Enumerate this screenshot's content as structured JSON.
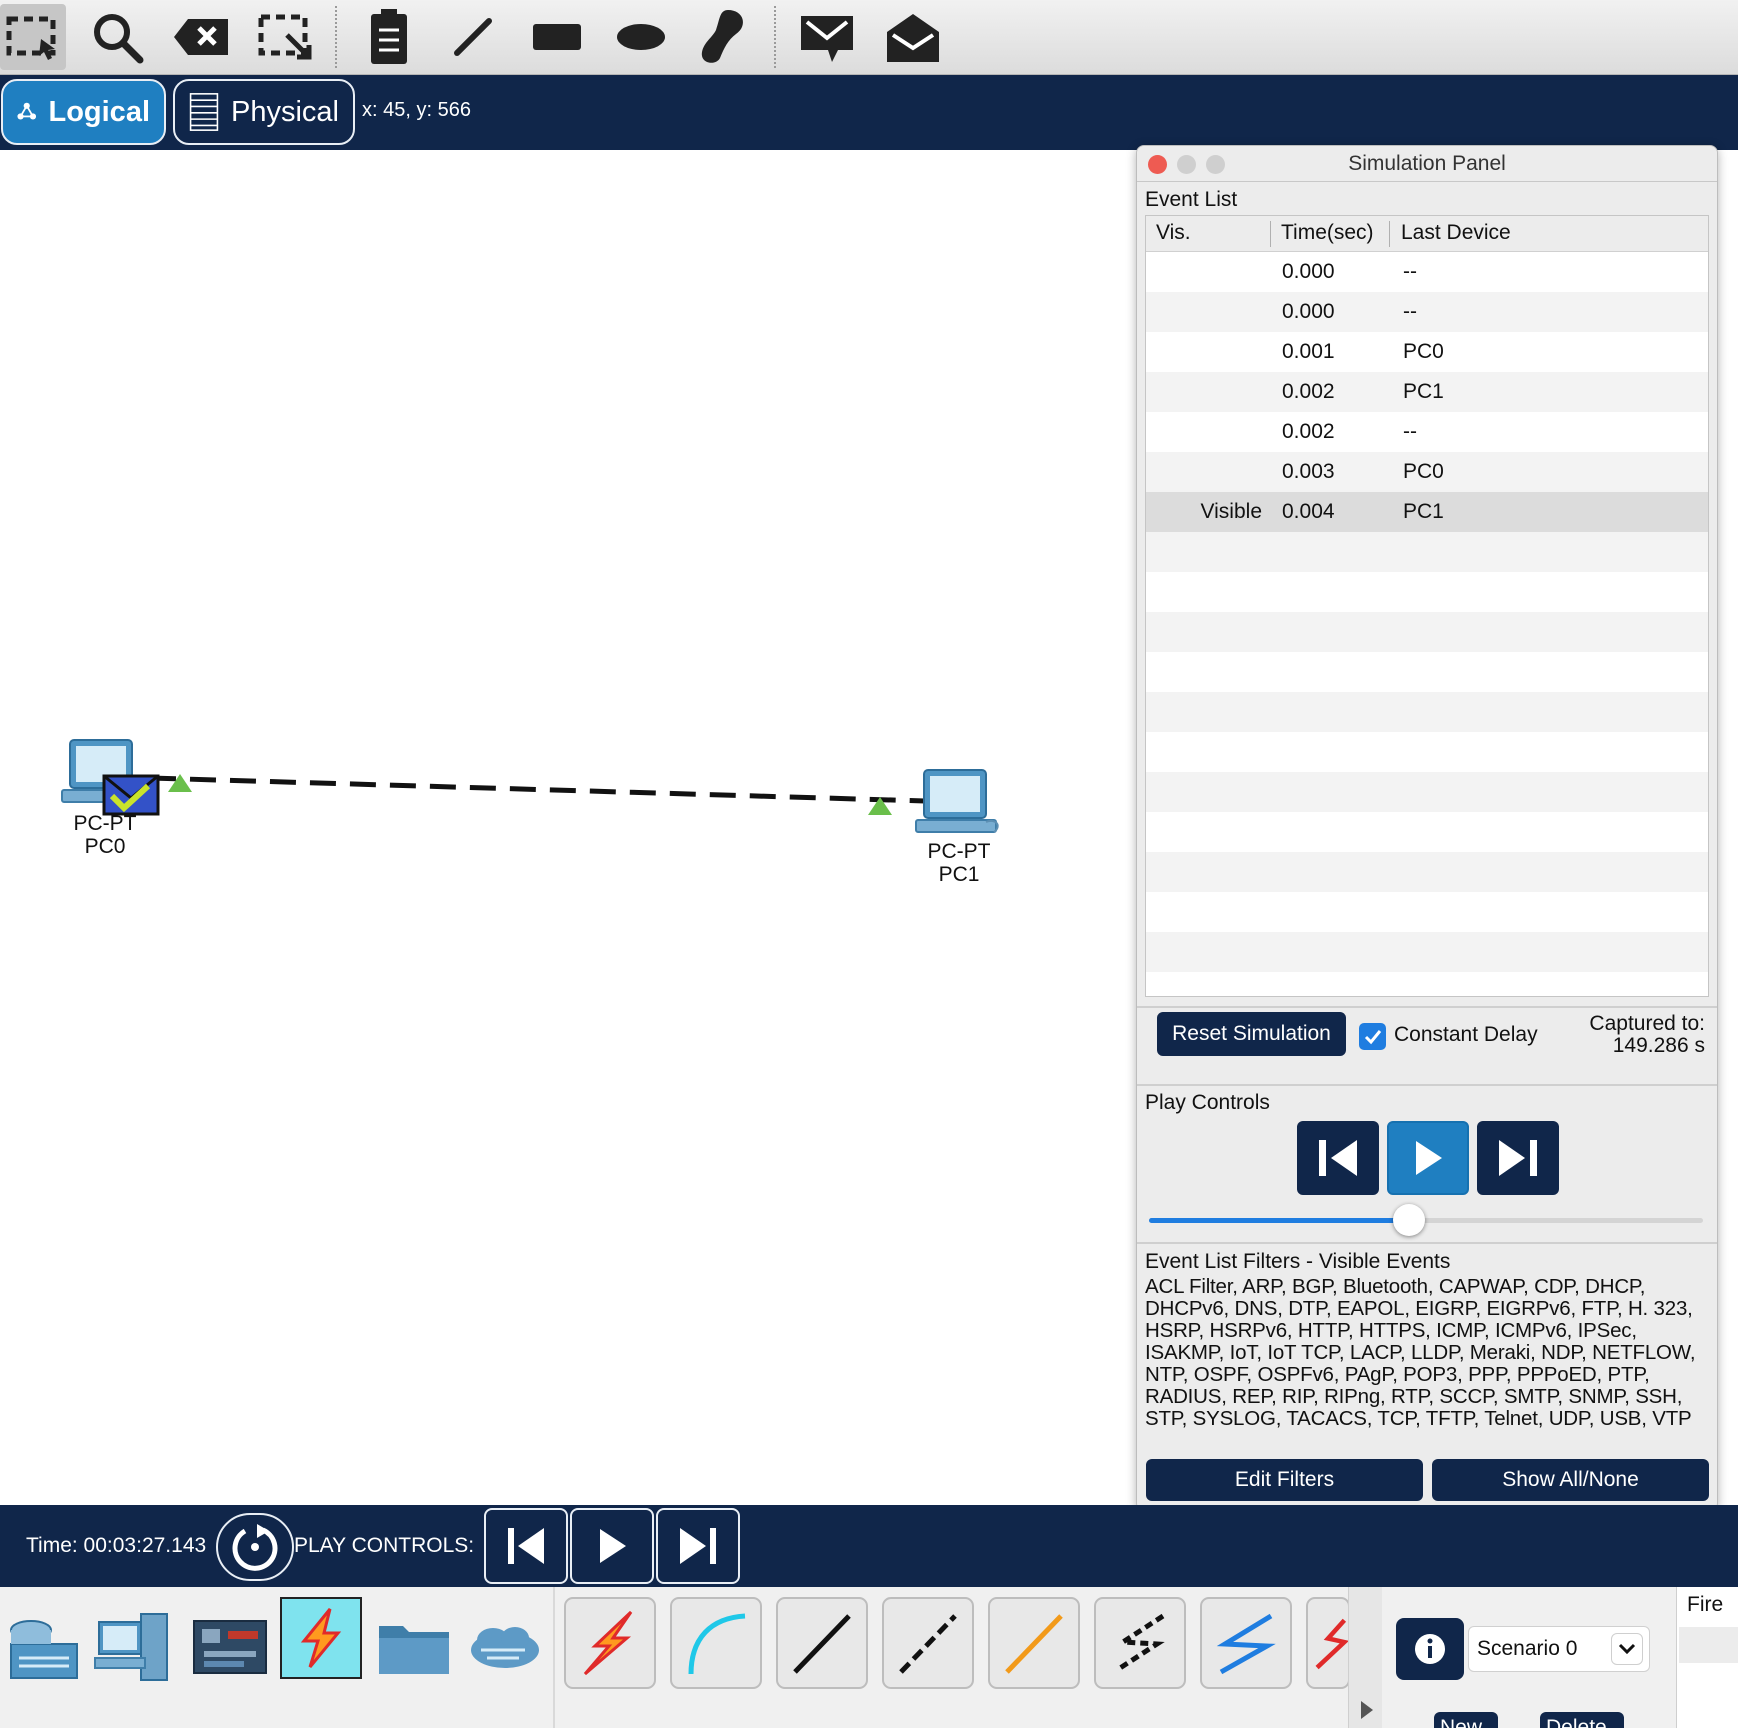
{
  "toolbar": {
    "tools": [
      "select-tool",
      "inspect-tool",
      "delete-tool",
      "resize-shape-tool",
      "place-note-tool",
      "draw-line-tool",
      "draw-rectangle-tool",
      "draw-ellipse-tool",
      "draw-freeform-tool",
      "add-simple-pdu-tool",
      "add-complex-pdu-tool"
    ]
  },
  "modebar": {
    "logical_label": "Logical",
    "physical_label": "Physical",
    "coordinates": "x: 45, y: 566"
  },
  "topology": {
    "devices": [
      {
        "type": "PC-PT",
        "name": "PC0"
      },
      {
        "type": "PC-PT",
        "name": "PC1"
      }
    ],
    "link_style": "dashed crossover cable",
    "link_status_color": "#6abf4b"
  },
  "sim_panel": {
    "title": "Simulation Panel",
    "event_list_label": "Event List",
    "columns": {
      "vis": "Vis.",
      "time": "Time(sec)",
      "last_device": "Last Device"
    },
    "events": [
      {
        "vis": "",
        "time": "0.000",
        "last_device": "--"
      },
      {
        "vis": "",
        "time": "0.000",
        "last_device": "--"
      },
      {
        "vis": "",
        "time": "0.001",
        "last_device": "PC0"
      },
      {
        "vis": "",
        "time": "0.002",
        "last_device": "PC1"
      },
      {
        "vis": "",
        "time": "0.002",
        "last_device": "--"
      },
      {
        "vis": "",
        "time": "0.003",
        "last_device": "PC0"
      },
      {
        "vis": "Visible",
        "time": "0.004",
        "last_device": "PC1"
      }
    ],
    "reset_label": "Reset Simulation",
    "constant_delay_label": "Constant Delay",
    "constant_delay_checked": true,
    "captured_label": "Captured to:",
    "captured_value": "149.286 s",
    "play_controls_label": "Play Controls",
    "speed_fraction": 0.47,
    "filters_label": "Event List Filters - Visible Events",
    "filters_text": "ACL Filter, ARP, BGP, Bluetooth, CAPWAP, CDP, DHCP, DHCPv6, DNS, DTP, EAPOL, EIGRP, EIGRPv6, FTP, H. 323, HSRP, HSRPv6, HTTP, HTTPS, ICMP, ICMPv6, IPSec, ISAKMP, IoT, IoT TCP, LACP, LLDP, Meraki, NDP, NETFLOW, NTP, OSPF, OSPFv6, PAgP, POP3, PPP, PPPoED, PTP, RADIUS, REP, RIP, RIPng, RTP, SCCP, SMTP, SNMP, SSH, STP, SYSLOG, TACACS, TCP, TFTP, Telnet, UDP, USB, VTP",
    "edit_filters_label": "Edit Filters",
    "show_all_label": "Show All/None"
  },
  "bottombar": {
    "time_label": "Time: 00:03:27.143",
    "play_controls_label": "PLAY CONTROLS:"
  },
  "drawer": {
    "categories": [
      "network-devices",
      "end-devices",
      "components",
      "connections",
      "miscellaneous",
      "multiuser-connection"
    ],
    "connections": [
      "automatic-connection",
      "console-cable",
      "copper-straight-through",
      "copper-cross-over",
      "fiber",
      "phone",
      "coaxial",
      "serial"
    ],
    "scenario": "Scenario 0",
    "new_label": "New",
    "delete_label": "Delete",
    "fire_label": "Fire"
  },
  "colors": {
    "navy": "#10264a",
    "accent_blue": "#1f7fc1",
    "check_blue": "#1f7de0"
  }
}
